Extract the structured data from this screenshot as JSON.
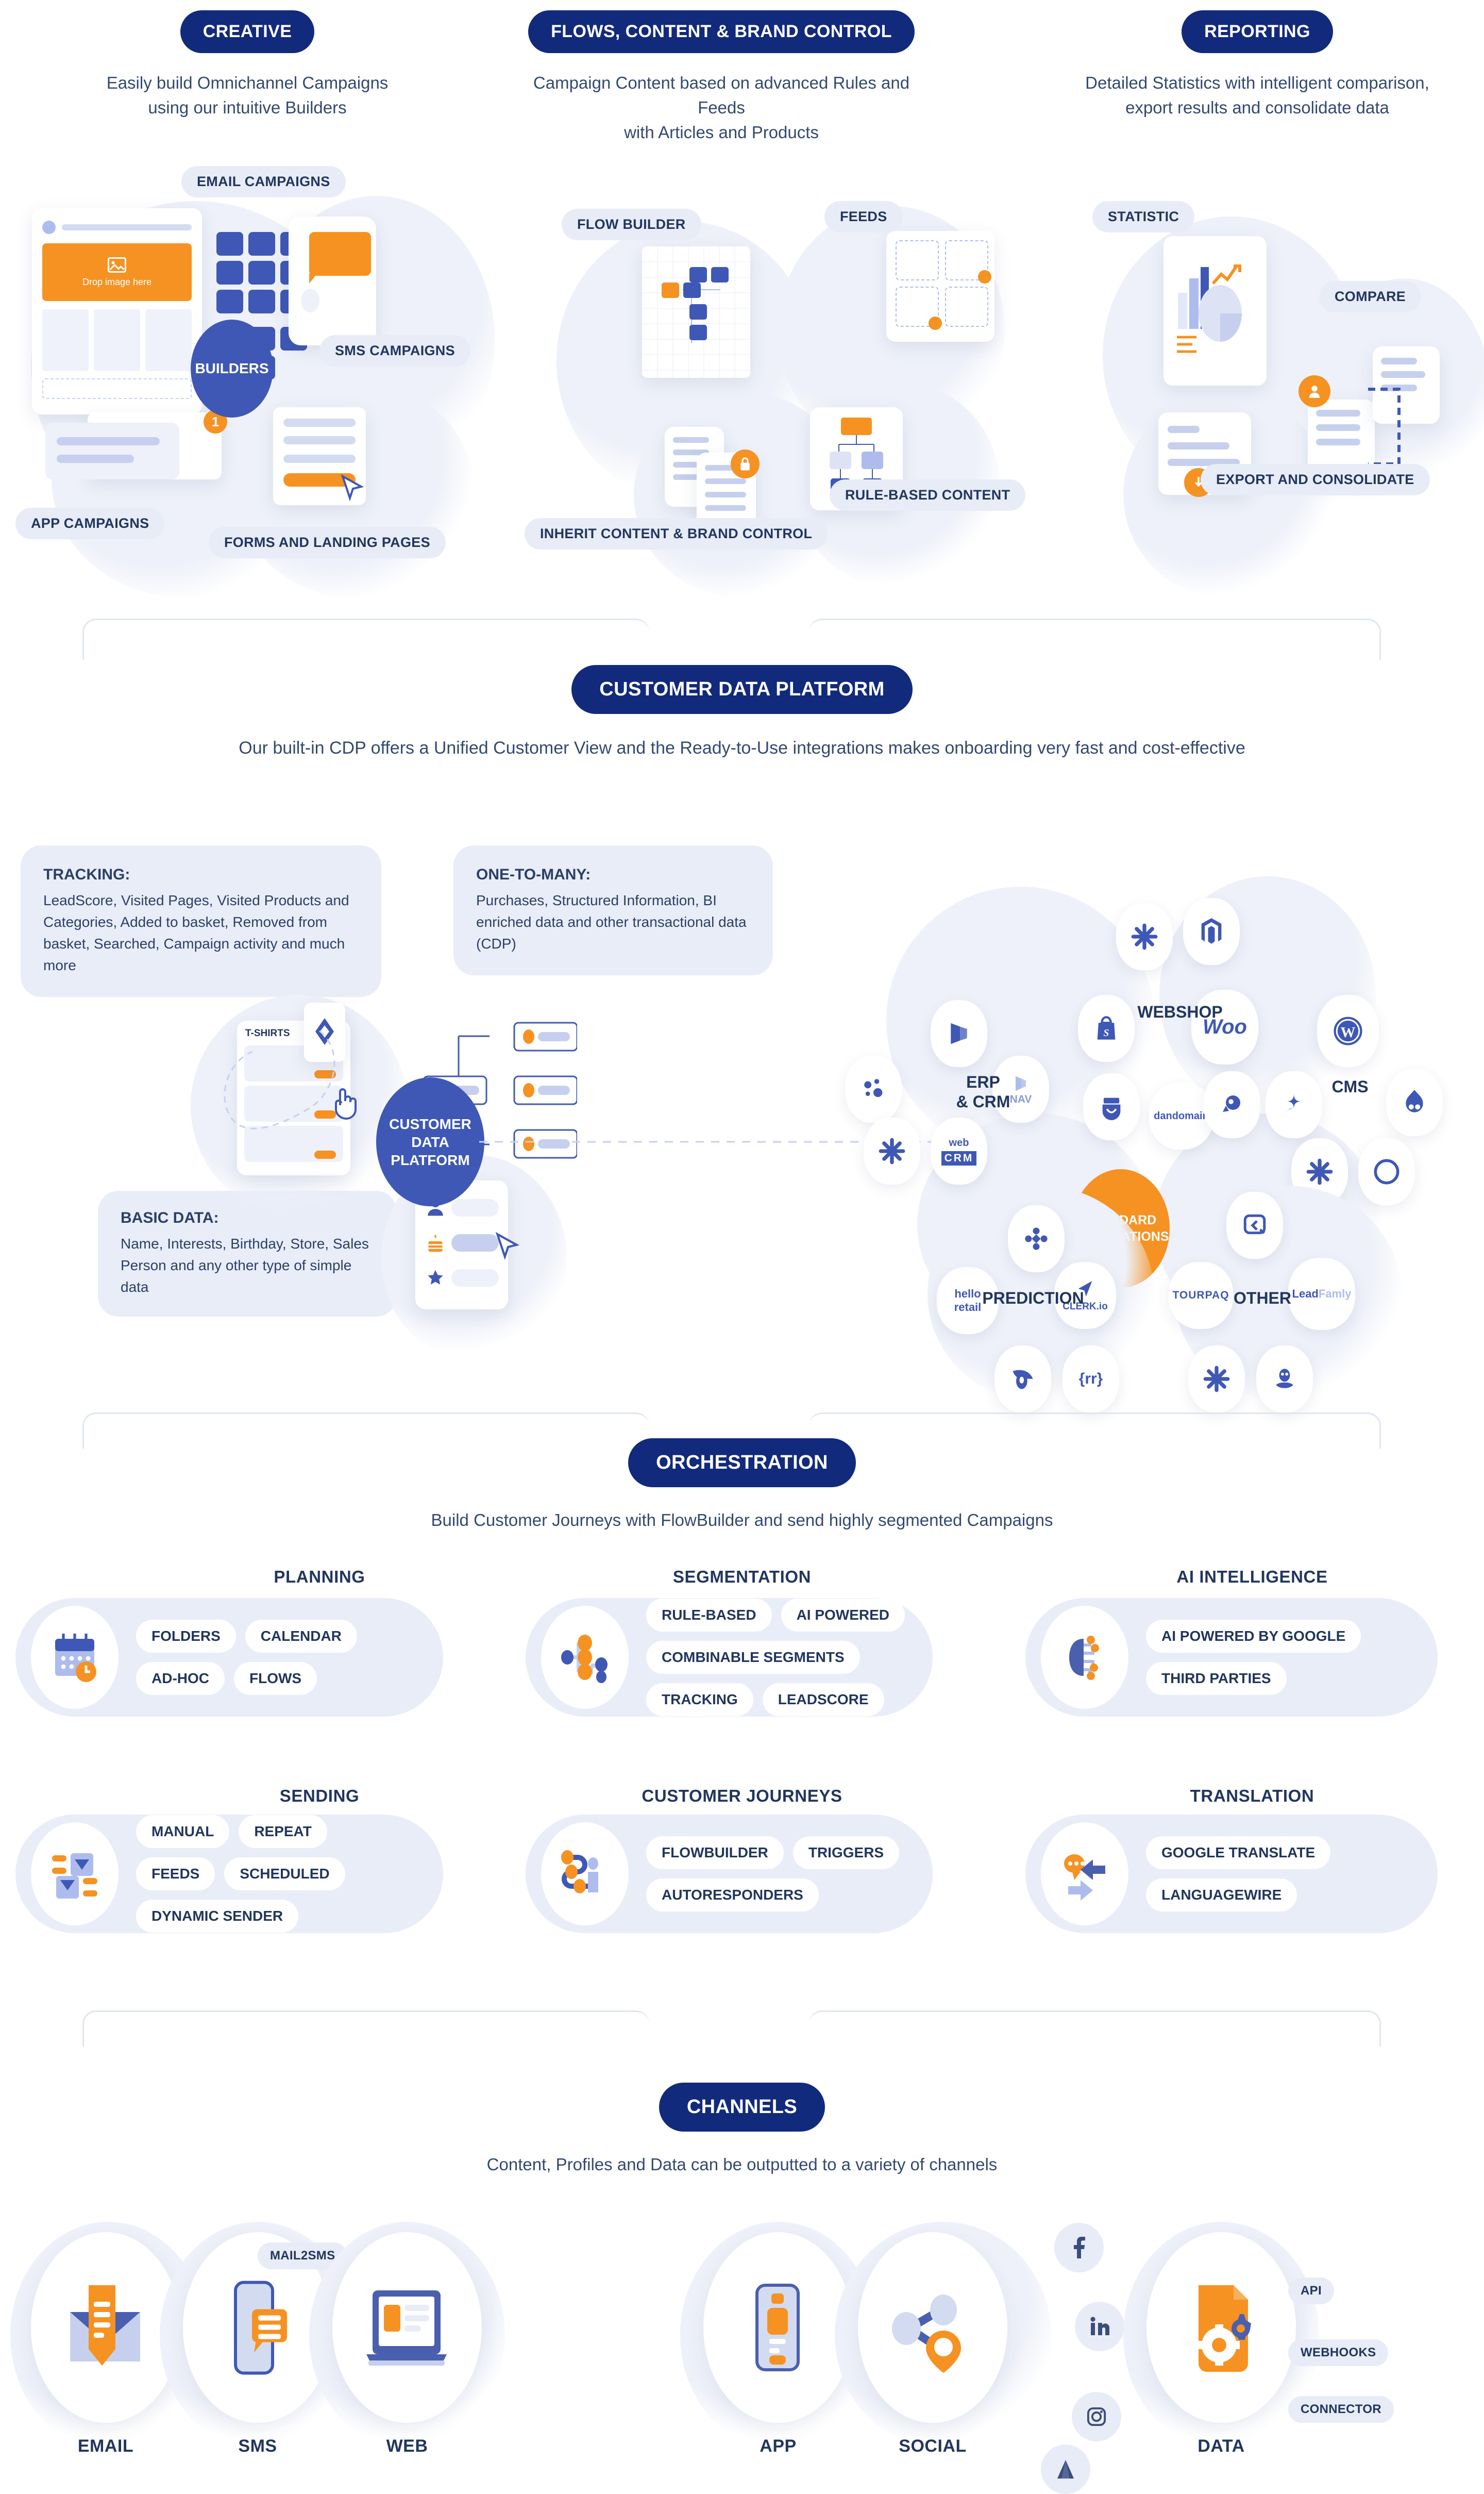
{
  "colors": {
    "navy": "#122a7c",
    "blue": "#3f58b5",
    "orange": "#f59222",
    "lightblue": "#aebced",
    "pale": "#e8ecf7",
    "text": "#21365e"
  },
  "top_sections": [
    {
      "badge": "CREATIVE",
      "caption_line1": "Easily build Omnichannel Campaigns",
      "caption_line2": "using our intuitive Builders",
      "hub": "BUILDERS",
      "tags": [
        "EMAIL CAMPAIGNS",
        "SMS CAMPAIGNS",
        "APP CAMPAIGNS",
        "FORMS AND LANDING PAGES"
      ],
      "drop_label": "Drop image here"
    },
    {
      "badge": "FLOWS, CONTENT & BRAND CONTROL",
      "caption_line1": "Campaign Content based on advanced Rules and Feeds",
      "caption_line2": "with Articles and Products",
      "tags": [
        "FLOW BUILDER",
        "FEEDS",
        "INHERIT CONTENT & BRAND CONTROL",
        "RULE-BASED CONTENT"
      ]
    },
    {
      "badge": "REPORTING",
      "caption_line1": "Detailed Statistics with intelligent comparison,",
      "caption_line2": "export results and consolidate data",
      "tags": [
        "STATISTIC",
        "COMPARE",
        "EXPORT AND CONSOLIDATE"
      ]
    }
  ],
  "cdp": {
    "badge": "CUSTOMER DATA PLATFORM",
    "caption": "Our built-in CDP offers a Unified Customer View and the Ready-to-Use  integrations makes onboarding very fast and cost-effective",
    "hub": "CUSTOMER DATA PLATFORM",
    "hub_lines": [
      "CUSTOMER",
      "DATA",
      "PLATFORM"
    ],
    "boxes": [
      {
        "title": "TRACKING:",
        "body": "LeadScore, Visited Pages, Visited Products and Categories, Added to basket, Removed from basket, Searched, Campaign activity and much more"
      },
      {
        "title": "ONE-TO-MANY:",
        "body": "Purchases, Structured Information, BI enriched data and other transactional data (CDP)"
      },
      {
        "title": "BASIC DATA:",
        "body": "Name, Interests, Birthday, Store, Sales Person and any other type of simple data"
      }
    ],
    "product_card_label": "T-SHIRTS",
    "integrations_hub_lines": [
      "STANDARD",
      "INTEGRATIONS"
    ],
    "integration_groups": [
      {
        "label": "ERP\n& CRM",
        "label_lines": [
          "ERP",
          "& CRM"
        ],
        "logos": [
          "dynamics-365-icon",
          "zapier-icon",
          "dynamics-nav-icon",
          "zapier-icon",
          "webcrm-icon"
        ]
      },
      {
        "label": "WEBSHOP",
        "label_lines": [
          "WEBSHOP"
        ],
        "logos": [
          "zapier-icon",
          "magento-icon",
          "shopify-icon",
          "woocommerce-icon",
          "smartweb-icon",
          "dandomain-icon",
          "prestashop-icon"
        ]
      },
      {
        "label": "CMS",
        "label_lines": [
          "CMS"
        ],
        "logos": [
          "wordpress-icon",
          "sitecore-icon",
          "drupal-icon",
          "zapier-icon",
          "umbraco-icon"
        ]
      },
      {
        "label": "PREDICTION",
        "label_lines": [
          "PREDICTION"
        ],
        "logos": [
          "raptor-icon",
          "hello-retail-icon",
          "clerk-io-icon",
          "conversio-icon",
          "rr-icon"
        ]
      },
      {
        "label": "OTHER",
        "label_lines": [
          "OTHER"
        ],
        "logos": [
          "zendesk-icon",
          "tourpaq-icon",
          "leadfamly-icon",
          "zapier-icon",
          "mailchimp-icon"
        ]
      }
    ],
    "logo_text": {
      "nav": "NAV",
      "webcrm_top": "web",
      "webcrm_bottom": "CRM",
      "woo": "Woo",
      "dandomain": "dandomain",
      "hello_retail_1": "hello",
      "hello_retail_2": "retail",
      "clerk": "CLERK.io",
      "tourpaq": "TOURPAQ",
      "leadfamly_bold": "Lead",
      "leadfamly_light": "Famly",
      "rr": "{rr}"
    }
  },
  "orchestration": {
    "badge": "ORCHESTRATION",
    "caption": "Build Customer Journeys with FlowBuilder and send highly segmented Campaigns",
    "cards": [
      {
        "title": "PLANNING",
        "icon": "calendar-clock-icon",
        "chips": [
          "FOLDERS",
          "CALENDAR",
          "AD-HOC",
          "FLOWS"
        ]
      },
      {
        "title": "SEGMENTATION",
        "icon": "segment-tree-icon",
        "chips": [
          "RULE-BASED",
          "AI POWERED",
          "COMBINABLE SEGMENTS",
          "TRACKING",
          "LEADSCORE"
        ]
      },
      {
        "title": "AI INTELLIGENCE",
        "icon": "ai-brain-icon",
        "chips": [
          "AI POWERED BY GOOGLE",
          "THIRD PARTIES"
        ]
      },
      {
        "title": "SENDING",
        "icon": "send-sliders-icon",
        "chips": [
          "MANUAL",
          "REPEAT",
          "FEEDS",
          "SCHEDULED",
          "DYNAMIC SENDER"
        ]
      },
      {
        "title": "CUSTOMER JOURNEYS",
        "icon": "journey-path-icon",
        "chips": [
          "FLOWBUILDER",
          "TRIGGERS",
          "AUTORESPONDERS"
        ]
      },
      {
        "title": "TRANSLATION",
        "icon": "translate-arrows-icon",
        "chips": [
          "GOOGLE TRANSLATE",
          "LANGUAGEWIRE"
        ]
      }
    ]
  },
  "channels": {
    "badge": "CHANNELS",
    "caption": "Content, Profiles and Data can be outputted to a variety of channels",
    "items": [
      {
        "label": "EMAIL",
        "icon": "email-envelope-icon",
        "tags": []
      },
      {
        "label": "SMS",
        "icon": "sms-phone-icon",
        "tags": [
          "MAIL2SMS"
        ]
      },
      {
        "label": "WEB",
        "icon": "web-browser-icon",
        "tags": []
      },
      {
        "label": "APP",
        "icon": "app-phone-icon",
        "tags": [],
        "minis": [
          "firebase-icon"
        ]
      },
      {
        "label": "SOCIAL",
        "icon": "social-share-icon",
        "tags": [],
        "minis": [
          "facebook-icon",
          "linkedin-icon",
          "instagram-icon",
          "google-ads-icon"
        ]
      },
      {
        "label": "DATA",
        "icon": "data-gears-icon",
        "tags": [
          "API",
          "WEBHOOKS",
          "CONNECTOR"
        ]
      }
    ]
  }
}
